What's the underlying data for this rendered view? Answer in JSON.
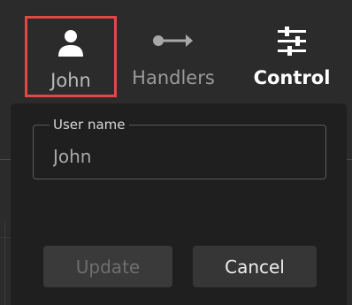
{
  "nav": {
    "user": {
      "label": "John",
      "icon": "user-icon"
    },
    "handlers": {
      "label": "Handlers",
      "icon": "arrow-handler-icon"
    },
    "control": {
      "label": "Control",
      "icon": "sliders-icon"
    }
  },
  "popover": {
    "user_name_field": {
      "label": "User name",
      "value": "John"
    },
    "update_label": "Update",
    "cancel_label": "Cancel"
  },
  "colors": {
    "highlight": "#e04848",
    "panel_bg": "#1f1f1f",
    "page_bg": "#2b2b2b"
  }
}
